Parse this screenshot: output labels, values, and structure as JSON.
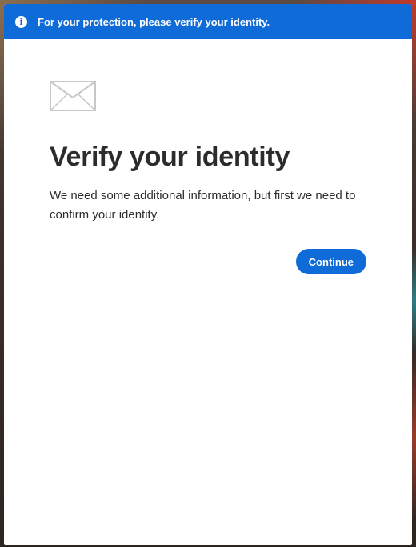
{
  "banner": {
    "icon": "info-icon",
    "text": "For your protection, please verify your identity."
  },
  "main": {
    "icon": "mail-envelope-icon",
    "title": "Verify your identity",
    "description": "We need some additional information, but first we need to confirm your identity.",
    "continue_label": "Continue"
  },
  "colors": {
    "accent": "#0f6bd8",
    "text": "#2c2c2c",
    "icon_gray": "#c8c8c8"
  }
}
